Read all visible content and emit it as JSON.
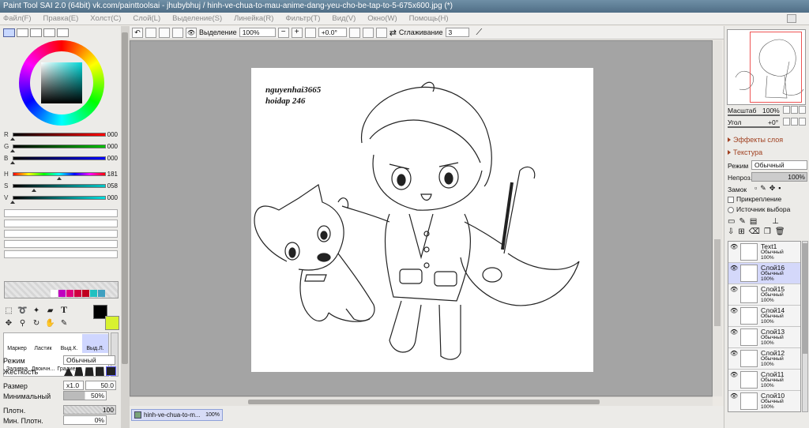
{
  "window": {
    "title": "Paint Tool SAI 2.0 (64bit) vk.com/painttoolsai - jhubybhuj / hinh-ve-chua-to-mau-anime-dang-yeu-cho-be-tap-to-5-675x600.jpg (*)"
  },
  "menu": [
    "Файл(F)",
    "Правка(E)",
    "Холст(C)",
    "Слой(L)",
    "Выделение(S)",
    "Линейка(R)",
    "Фильтр(T)",
    "Вид(V)",
    "Окно(W)",
    "Помощь(H)"
  ],
  "color_sliders": [
    {
      "label": "R",
      "value": "000",
      "color": "#ff0000",
      "knob": 0.0
    },
    {
      "label": "G",
      "value": "000",
      "color": "#00c000",
      "knob": 0.0
    },
    {
      "label": "B",
      "value": "000",
      "color": "#0000ff",
      "knob": 0.0
    },
    {
      "label": "H",
      "value": "181",
      "color": "hue",
      "knob": 0.5
    },
    {
      "label": "S",
      "value": "058",
      "color": "#00c8c8",
      "knob": 0.23
    },
    {
      "label": "V",
      "value": "000",
      "color": "#00e0e0",
      "knob": 0.0
    }
  ],
  "palette_colors": [
    "#ffffff",
    "#c000c0",
    "#e00080",
    "#d00040",
    "#c00020",
    "#20c0c0",
    "#40a0c0"
  ],
  "colors": {
    "foreground": "#000000",
    "background": "#d8f230"
  },
  "brushes": [
    {
      "label": "Маркер"
    },
    {
      "label": "Ластик"
    },
    {
      "label": "Выд.К."
    },
    {
      "label": "Выд.Л."
    },
    {
      "label": "Заливка"
    },
    {
      "label": "Двоичн..."
    },
    {
      "label": "Градиент"
    }
  ],
  "brush_props": {
    "mode_label": "Режим",
    "mode_value": "Обычный",
    "hardness_label": "Жесткость",
    "size_label": "Размер",
    "size_mult": "x1.0",
    "size_value": "50.0",
    "min_label": "Минимальный",
    "min_value": "50%",
    "density_label": "Плотн.",
    "density_value": "100",
    "min_density_label": "Мин. Плотн.",
    "min_density_value": "0%"
  },
  "toolbar": {
    "selection_label": "Выделение",
    "zoom": "100%",
    "rotation": "+0.0°",
    "smoothing_label": "Сглаживание",
    "smoothing_value": "3"
  },
  "canvas": {
    "signature_line1": "nguyenhai3665",
    "signature_line2": "hoidap 246"
  },
  "doc_tab": {
    "name": "hinh-ve-chua-to-m...",
    "zoom": "100%"
  },
  "navigator": {
    "scale_label": "Масштаб",
    "scale_value": "100%",
    "angle_label": "Угол",
    "angle_value": "+0°"
  },
  "layer_panel": {
    "effects_label": "Эффекты слоя",
    "texture_label": "Текстура",
    "mode_label": "Режим",
    "mode_value": "Обычный",
    "opacity_label": "Непроз.",
    "opacity_value": "100%",
    "lock_label": "Замок",
    "clip_label": "Прикрепление",
    "source_label": "Источник выбора"
  },
  "layers": [
    {
      "name": "Text1",
      "mode": "Обычный",
      "opacity": "100%",
      "selected": false
    },
    {
      "name": "Слой16",
      "mode": "Обычный",
      "opacity": "100%",
      "selected": true
    },
    {
      "name": "Слой15",
      "mode": "Обычный",
      "opacity": "100%",
      "selected": false
    },
    {
      "name": "Слой14",
      "mode": "Обычный",
      "opacity": "100%",
      "selected": false
    },
    {
      "name": "Слой13",
      "mode": "Обычный",
      "opacity": "100%",
      "selected": false
    },
    {
      "name": "Слой12",
      "mode": "Обычный",
      "opacity": "100%",
      "selected": false
    },
    {
      "name": "Слой11",
      "mode": "Обычный",
      "opacity": "100%",
      "selected": false
    },
    {
      "name": "Слой10",
      "mode": "Обычный",
      "opacity": "100%",
      "selected": false
    }
  ]
}
